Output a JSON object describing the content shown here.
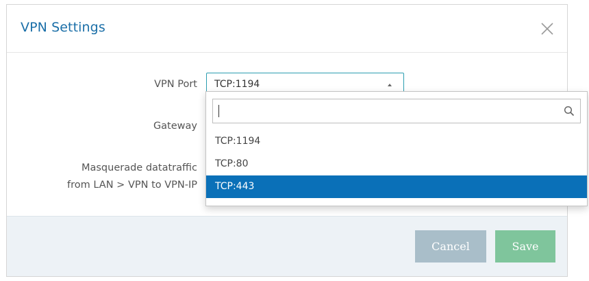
{
  "dialog": {
    "title": "VPN Settings"
  },
  "form": {
    "vpn_port_label": "VPN Port",
    "gateway_label": "Gateway",
    "masquerade_label_line1": "Masquerade datatraffic",
    "masquerade_label_line2": "from LAN > VPN to VPN-IP",
    "vpn_port_selected": "TCP:1194"
  },
  "dropdown": {
    "search_value": "",
    "options": [
      {
        "label": "TCP:1194",
        "selected": false
      },
      {
        "label": "TCP:80",
        "selected": false
      },
      {
        "label": "TCP:443",
        "selected": true
      }
    ]
  },
  "footer": {
    "cancel_label": "Cancel",
    "save_label": "Save"
  },
  "icons": {
    "close": "close-icon",
    "caret": "caret-up-icon",
    "search": "search-icon"
  },
  "colors": {
    "title": "#1b6fa8",
    "select_border": "#2a9db0",
    "selected_option": "#0a70b8",
    "cancel_button": "#a9bec9",
    "save_button": "#7fc59c",
    "footer_bg": "#edf2f6"
  }
}
